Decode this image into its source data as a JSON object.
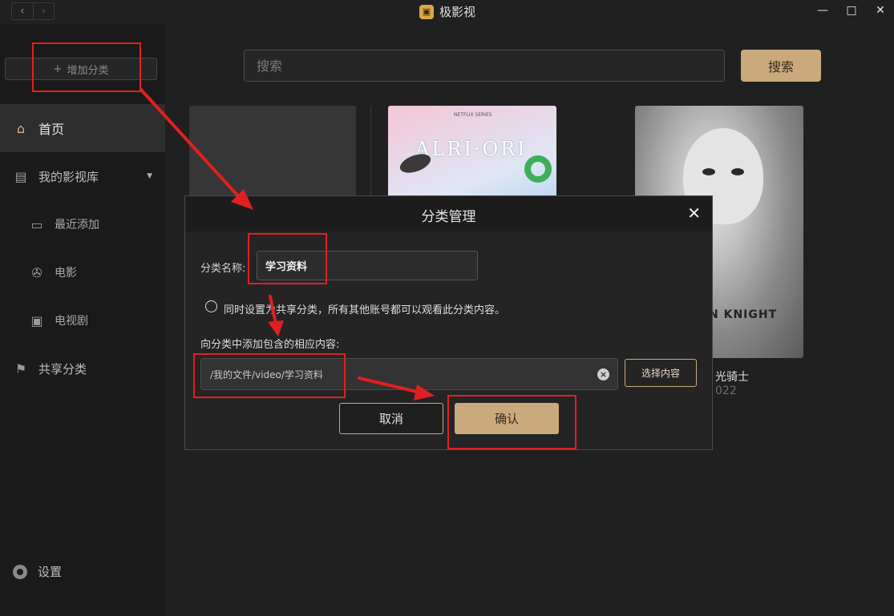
{
  "window": {
    "title": "极影视",
    "back_icon": "‹",
    "forward_icon": "›",
    "minimize": "—",
    "maximize": "□",
    "close": "✕"
  },
  "sidebar": {
    "add_category": "增加分类",
    "add_icon": "+",
    "items": [
      {
        "label": "首页",
        "icon": "home-icon"
      },
      {
        "label": "我的影视库",
        "icon": "film-library-icon"
      },
      {
        "label": "最近添加",
        "icon": "recent-icon"
      },
      {
        "label": "电影",
        "icon": "film-reel-icon"
      },
      {
        "label": "电视剧",
        "icon": "tv-icon"
      },
      {
        "label": "共享分类",
        "icon": "share-icon"
      }
    ],
    "settings_label": "设置"
  },
  "search": {
    "placeholder": "搜索",
    "button_label": "搜索"
  },
  "posters": [
    {
      "tag": "NETFLIX SERIES",
      "title": "ALRI·ORI"
    },
    {
      "logo": "N KNIGHT",
      "title_partial": "光骑士",
      "year_partial": "022"
    }
  ],
  "dialog": {
    "title": "分类管理",
    "close_icon": "✕",
    "name_label": "分类名称:",
    "name_value": "学习资料",
    "share_option": "同时设置为共享分类，所有其他账号都可以观看此分类内容。",
    "content_label": "向分类中添加包含的相应内容:",
    "path_value": "/我的文件/video/学习资料",
    "clear_icon": "×",
    "select_button": "选择内容",
    "cancel_button": "取消",
    "confirm_button": "确认"
  },
  "colors": {
    "accent": "#caa97c",
    "annotation": "#e02020",
    "background": "#1f1f1f"
  }
}
